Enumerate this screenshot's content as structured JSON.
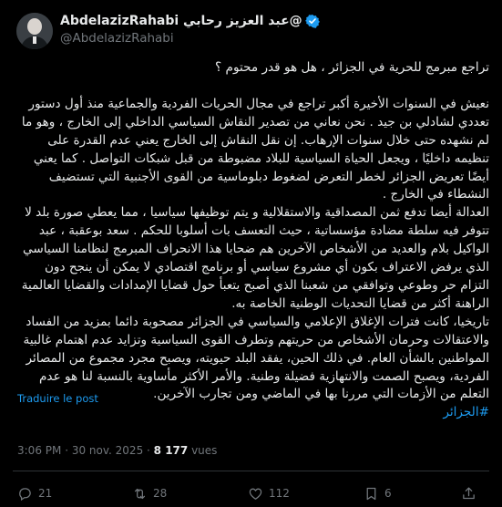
{
  "author": {
    "display_name": "@عبد العزيز رحابي AbdelazizRahabi",
    "handle": "@AbdelazizRahabi"
  },
  "post": {
    "title_line": "تراجع مبرمج للحرية في الجزائر ، هل هو قدر محتوم ؟",
    "paragraph1": "نعيش في السنوات الأخيرة أكبر تراجع في مجال الحريات الفردية والجماعية منذ أول دستور تعددي لشادلي بن جيد . نحن نعاني من تصدير النقاش السياسي الداخلي إلى الخارج ، وهو ما لم نشهده حتى خلال سنوات الإرهاب. إن نقل النقاش إلى الخارج يعني عدم القدرة على تنظيمه داخليًا ، ويجعل الحياة السياسية للبلاد مضبوطة من قبل شبكات التواصل . كما يعني أيضًا تعريض الجزائر لخطر التعرض لضغوط دبلوماسية من القوى الأجنبية التي تستضيف النشطاء في الخارج .",
    "paragraph2": "العدالة أيضا تدفع ثمن المصداقية والاستقلالية و يتم توظيفها سياسيا ، مما يعطي صورة بلد لا تتوفر فيه سلطة مضادة مؤسساتية ، حيث التعسف بات أسلوبا للحكم . سعد بوعقبة ، عبد الواكيل بلام والعديد من الأشخاص الآخرين هم ضحايا هذا الانحراف المبرمج لنظامنا السياسي الذي يرفض الاعتراف بكون أي مشروع سياسي أو برنامج اقتصادي لا يمكن أن ينجح دون التزام حر وطوعي وتوافقي من شعبنا الذي أصبح يتعبأ حول قضايا الإمدادات والقضايا العالمية الراهنة أكثر من قضايا التحديات الوطنية الخاصة به.",
    "paragraph3": "تاريخيا، كانت فترات الإغلاق الإعلامي والسياسي في الجزائر مصحوبة دائما بمزيد من الفساد والاعتقالات وحرمان الأشخاص من حريتهم وتطرف القوى السياسية وتزايد عدم اهتمام غالبية المواطنين بالشأن العام. في ذلك الحين، يفقد البلد حيويته، ويصبح مجرد مجموع من المصائر الفردية، ويصبح الصمت والانتهازية فضيلة وطنية. والأمر الأكثر مأساوية بالنسبة لنا هو عدم التعلم من الأزمات التي مررنا بها في الماضي ومن تجارب الآخرين.",
    "hashtag": "#الجزائر",
    "translate_label": "Traduire le post",
    "time": "3:06 PM",
    "date": "30 nov. 2025",
    "views_count": "8 177",
    "views_label": "vues"
  },
  "actions": {
    "replies": "21",
    "reposts": "28",
    "likes": "112",
    "bookmarks": "6"
  },
  "colors": {
    "accent": "#1d9bf0",
    "muted": "#71767b",
    "text": "#e7e9ea",
    "background": "#000000"
  }
}
